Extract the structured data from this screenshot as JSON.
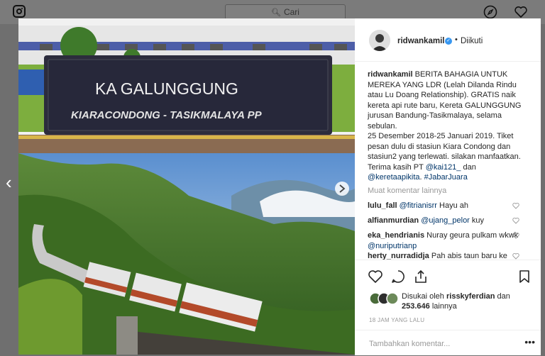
{
  "search": {
    "placeholder": "Cari"
  },
  "post": {
    "image": {
      "sign_title": "KA GALUNGGUNG",
      "sign_route": "KIARACONDONG  - TASIKMALAYA PP"
    },
    "header": {
      "username": "ridwankamil",
      "dot": "•",
      "follow_status": "Diikuti"
    },
    "caption": {
      "username": "ridwankamil",
      "text_1": " BERITA BAHAGIA UNTUK MEREKA YANG LDR (Lelah Dilanda Rindu atau Lu Doang Relationship). GRATIS naik kereta api rute baru, Kereta GALUNGGUNG jurusan Bandung-Tasikmalaya, selama sebulan.",
      "text_2": "25 Desember 2018-25 Januari 2019. Tiket pesan dulu di stasiun Kiara Condong dan stasiun2 yang terlewati. silakan manfaatkan. Terima kasih PT ",
      "mention_1": "@kai121_",
      "text_3": " dan ",
      "mention_2": "@keretaapikita",
      "text_4": ". ",
      "hashtag": "#JabarJuara"
    },
    "load_more": "Muat komentar lainnya",
    "comments": [
      {
        "user": "lulu_fall",
        "mention": "@fitrianisrr",
        "text": " Hayu ah"
      },
      {
        "user": "alfianmurdian",
        "mention": "@ujang_pelor",
        "text": " kuy"
      },
      {
        "user": "eka_hendrianis",
        "text": " Nuray geura pulkam wkwk ",
        "mention": "@nuriputrianp"
      },
      {
        "user": "herty_nurradidja",
        "text": " Pah abis taun baru ke bawang pulang ane dede...mawnya"
      }
    ],
    "likes": {
      "prefix": "Disukai oleh ",
      "user": "risskyferdian",
      "middle": " dan",
      "count": "253.646",
      "suffix": " lainnya"
    },
    "timestamp": "18 JAM YANG LALU",
    "add_comment_placeholder": "Tambahkan komentar...",
    "more_options": "•••"
  },
  "colors": {
    "link": "#003569",
    "verified": "#3897f0",
    "overlay": "#6f6f6f"
  }
}
